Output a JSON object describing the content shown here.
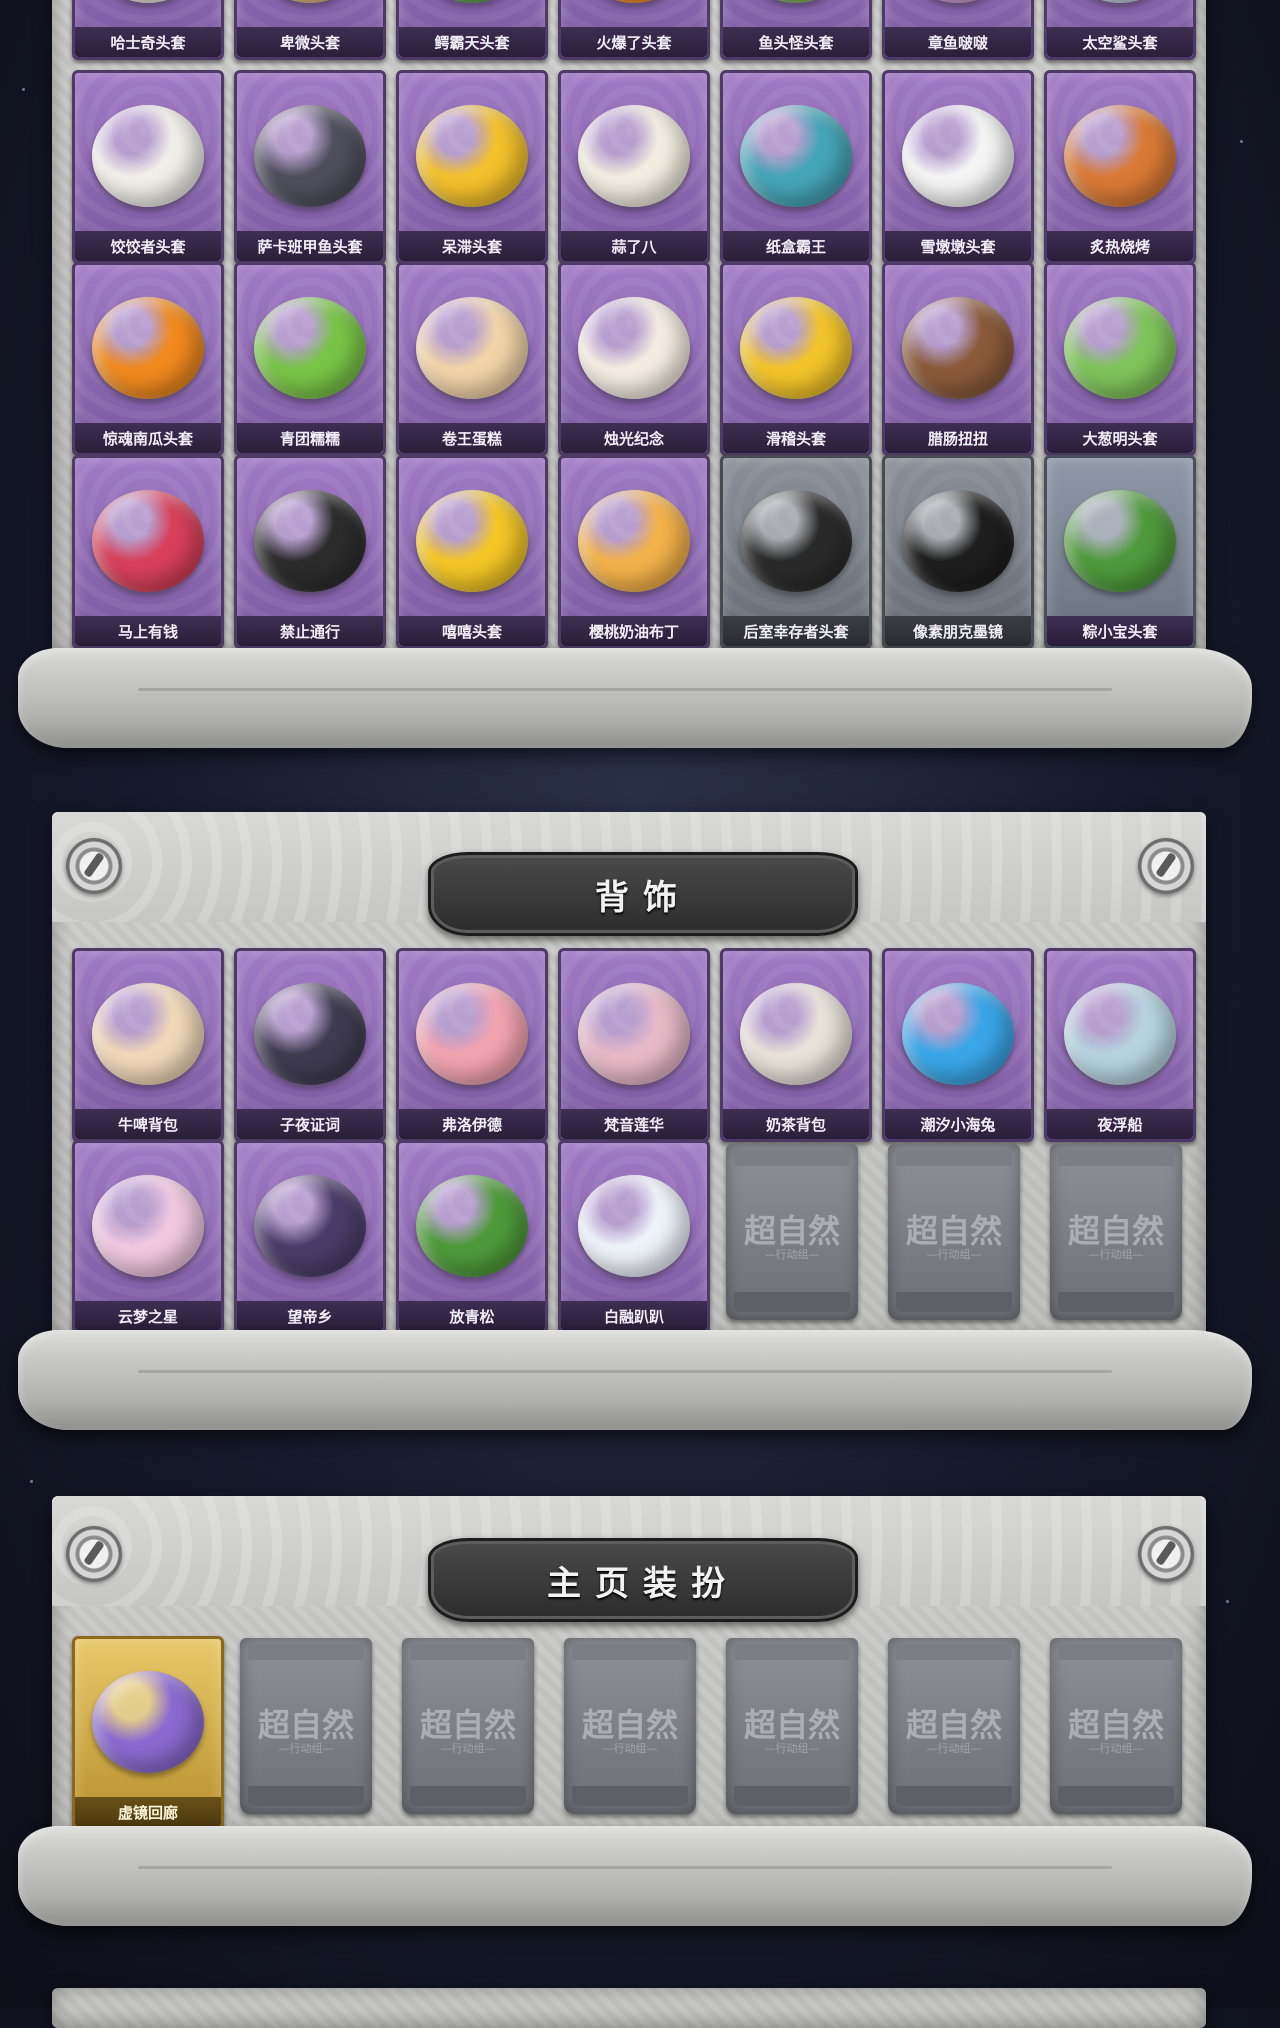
{
  "colors": {
    "card_purple": "#8a66b2",
    "card_gray": "#7a7f88",
    "card_gold": "#d4b04c",
    "panel_stone": "#c6c6c4",
    "banner_dark": "#333333",
    "background": "#161a2a"
  },
  "headwear": {
    "row1": [
      {
        "label": "哈士奇头套",
        "icon": "husky-head-icon",
        "color": "#e8e3da"
      },
      {
        "label": "卑微头套",
        "icon": "humble-head-icon",
        "color": "#d7b479"
      },
      {
        "label": "鳄霸天头套",
        "icon": "crocodile-head-icon",
        "color": "#5f9a4e"
      },
      {
        "label": "火爆了头套",
        "icon": "fire-head-icon",
        "color": "#f08a2c"
      },
      {
        "label": "鱼头怪头套",
        "icon": "fish-monster-icon",
        "color": "#7fae5b"
      },
      {
        "label": "章鱼啵啵",
        "icon": "octopus-icon",
        "color": "#c99bc9"
      },
      {
        "label": "太空鲨头套",
        "icon": "space-shark-icon",
        "color": "#c0c8d6"
      }
    ],
    "row2": [
      {
        "label": "饺饺者头套",
        "icon": "dumpling-head-icon",
        "color": "#f1efe9"
      },
      {
        "label": "萨卡班甲鱼头套",
        "icon": "sacabambaspis-icon",
        "color": "#4f4f5c"
      },
      {
        "label": "呆滞头套",
        "icon": "dazed-face-icon",
        "color": "#f3c12c"
      },
      {
        "label": "蒜了八",
        "icon": "garlic-icon",
        "color": "#f2ede0"
      },
      {
        "label": "纸盒霸王",
        "icon": "cardboard-dino-icon",
        "color": "#45a5b8"
      },
      {
        "label": "雪墩墩头套",
        "icon": "snowman-head-icon",
        "color": "#f5f5f5"
      },
      {
        "label": "炙热烧烤",
        "icon": "grilled-meat-icon",
        "color": "#d97a36"
      }
    ],
    "row3": [
      {
        "label": "惊魂南瓜头套",
        "icon": "pumpkin-head-icon",
        "color": "#f08a1e"
      },
      {
        "label": "青团糯糯",
        "icon": "green-dumpling-icon",
        "color": "#79c447"
      },
      {
        "label": "卷王蛋糕",
        "icon": "roll-cake-icon",
        "color": "#f2d3a8"
      },
      {
        "label": "烛光纪念",
        "icon": "candle-icon",
        "color": "#f4ece2"
      },
      {
        "label": "滑稽头套",
        "icon": "funny-face-icon",
        "color": "#f2c42a"
      },
      {
        "label": "腊肠扭扭",
        "icon": "dachshund-icon",
        "color": "#8a5a3a"
      },
      {
        "label": "大葱明头套",
        "icon": "scallion-head-icon",
        "color": "#7fc45a"
      }
    ],
    "row4": [
      {
        "label": "马上有钱",
        "icon": "horse-head-icon",
        "color": "#d8405a"
      },
      {
        "label": "禁止通行",
        "icon": "traffic-cone-icon",
        "color": "#2c2c2c"
      },
      {
        "label": "嘻嘻头套",
        "icon": "grin-face-icon",
        "color": "#f3c626"
      },
      {
        "label": "樱桃奶油布丁",
        "icon": "pudding-icon",
        "color": "#f4b24a"
      },
      {
        "label": "后室幸存者头套",
        "icon": "gas-mask-helmet-icon",
        "color": "#2a2a2a"
      },
      {
        "label": "像素朋克墨镜",
        "icon": "pixel-sunglasses-icon",
        "color": "#1e1e1e"
      },
      {
        "label": "粽小宝头套",
        "icon": "zongzi-head-icon",
        "color": "#4f9a3c"
      }
    ]
  },
  "backpack": {
    "title": "背饰",
    "row1": [
      {
        "label": "牛啤背包",
        "icon": "cow-beer-backpack-icon",
        "color": "#f1d8b8"
      },
      {
        "label": "子夜证词",
        "icon": "raven-mask-icon",
        "color": "#3f3c50"
      },
      {
        "label": "弗洛伊德",
        "icon": "pig-king-icon",
        "color": "#f2a3b0"
      },
      {
        "label": "梵音莲华",
        "icon": "lotus-doll-icon",
        "color": "#e8b9c8"
      },
      {
        "label": "奶茶背包",
        "icon": "milk-tea-qr-icon",
        "color": "#e9e2da"
      },
      {
        "label": "潮汐小海兔",
        "icon": "sea-bunny-icon",
        "color": "#3aa6e8"
      },
      {
        "label": "夜浮船",
        "icon": "jellyfish-icon",
        "color": "#b6d4e0"
      }
    ],
    "row2": [
      {
        "label": "云梦之星",
        "icon": "unicorn-star-icon",
        "color": "#f1c7e0"
      },
      {
        "label": "望帝乡",
        "icon": "opera-doll-icon",
        "color": "#4a3c6a"
      },
      {
        "label": "放青松",
        "icon": "bonsai-pine-icon",
        "color": "#4e9a3a"
      },
      {
        "label": "白融趴趴",
        "icon": "bear-pillow-icon",
        "color": "#eef3fa"
      }
    ],
    "placeholder_logo": "超自然",
    "placeholder_sub": "—行动组—",
    "placeholders_count": 3
  },
  "homepage": {
    "title": "主页装扮",
    "item": {
      "label": "虚镜回廊",
      "icon": "mirror-corridor-card-icon",
      "color": "#8a6ad0"
    },
    "placeholder_logo": "超自然",
    "placeholder_sub": "—行动组—",
    "placeholders_count": 6
  }
}
